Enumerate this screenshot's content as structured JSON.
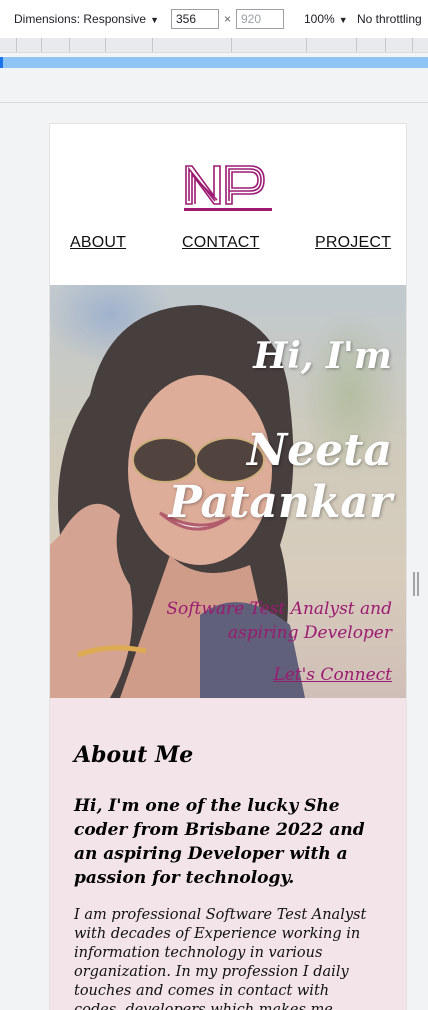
{
  "devtools": {
    "dimensions_label": "Dimensions: Responsive",
    "width_value": "356",
    "height_placeholder": "920",
    "times": "×",
    "zoom": "100%",
    "throttling": "No throttling",
    "caret": "▼"
  },
  "site": {
    "logo_text": "NP",
    "brand_color": "#9c1a72",
    "nav": {
      "about": "ABOUT",
      "contact": "CONTACT",
      "project": "PROJECT"
    },
    "hero": {
      "greeting": "Hi, I'm",
      "name_line1": "Neeta",
      "name_line2": "Patankar",
      "subtitle": "Software Test Analyst and aspiring Developer",
      "cta": "Let's Connect"
    },
    "about": {
      "heading": "About Me",
      "lead": "Hi, I'm one of the lucky She coder from Brisbane 2022 and an aspiring Developer with a passion for technology.",
      "body": "I am professional Software Test Analyst with decades of Experience working in information technology in various organization. In my profession I daily touches and comes in contact with codes, developers which makes me interested"
    }
  }
}
